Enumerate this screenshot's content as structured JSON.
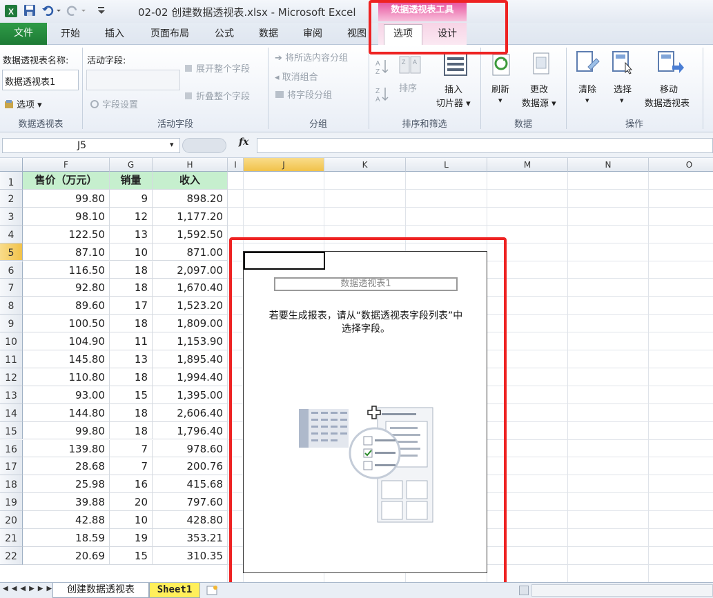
{
  "window": {
    "title": "02-02 创建数据透视表.xlsx  -  Microsoft Excel",
    "context_tools_header": "数据透视表工具"
  },
  "tabs": {
    "file": "文件",
    "items": [
      "开始",
      "插入",
      "页面布局",
      "公式",
      "数据",
      "审阅",
      "视图"
    ],
    "context_items": [
      "选项",
      "设计"
    ]
  },
  "ribbon": {
    "pivot_name_label": "数据透视表名称:",
    "pivot_name_value": "数据透视表1",
    "options_button": "选项",
    "active_field_label": "活动字段:",
    "field_settings": "字段设置",
    "expand_field": "展开整个字段",
    "collapse_field": "折叠整个字段",
    "group_selection": "将所选内容分组",
    "ungroup": "取消组合",
    "group_field": "将字段分组",
    "sort": "排序",
    "insert_slicer_1": "插入",
    "insert_slicer_2": "切片器",
    "refresh": "刷新",
    "change_source_1": "更改",
    "change_source_2": "数据源",
    "clear": "清除",
    "select": "选择",
    "move_1": "移动",
    "move_2": "数据透视表",
    "group_labels": [
      "数据透视表",
      "活动字段",
      "分组",
      "排序和筛选",
      "数据",
      "操作"
    ]
  },
  "formula_bar": {
    "name_box": "J5",
    "fx_label": "fx",
    "formula": ""
  },
  "grid": {
    "columns": [
      "F",
      "G",
      "H",
      "I",
      "J",
      "K",
      "L",
      "M",
      "N",
      "O"
    ],
    "selected_column": "J",
    "selected_row": "5",
    "row_numbers": [
      "1",
      "2",
      "3",
      "4",
      "5",
      "6",
      "7",
      "8",
      "9",
      "10",
      "11",
      "12",
      "13",
      "14",
      "15",
      "16",
      "17",
      "18",
      "19",
      "20",
      "21",
      "22"
    ],
    "headers": [
      "售价（万元）",
      "销量",
      "收入"
    ],
    "rows": [
      [
        "99.80",
        "9",
        "898.20"
      ],
      [
        "98.10",
        "12",
        "1,177.20"
      ],
      [
        "122.50",
        "13",
        "1,592.50"
      ],
      [
        "87.10",
        "10",
        "871.00"
      ],
      [
        "116.50",
        "18",
        "2,097.00"
      ],
      [
        "92.80",
        "18",
        "1,670.40"
      ],
      [
        "89.60",
        "17",
        "1,523.20"
      ],
      [
        "100.50",
        "18",
        "1,809.00"
      ],
      [
        "104.90",
        "11",
        "1,153.90"
      ],
      [
        "145.80",
        "13",
        "1,895.40"
      ],
      [
        "110.80",
        "18",
        "1,994.40"
      ],
      [
        "93.00",
        "15",
        "1,395.00"
      ],
      [
        "144.80",
        "18",
        "2,606.40"
      ],
      [
        "99.80",
        "18",
        "1,796.40"
      ],
      [
        "139.80",
        "7",
        "978.60"
      ],
      [
        "28.68",
        "7",
        "200.76"
      ],
      [
        "25.98",
        "16",
        "415.68"
      ],
      [
        "39.88",
        "20",
        "797.60"
      ],
      [
        "42.88",
        "10",
        "428.80"
      ],
      [
        "18.59",
        "19",
        "353.21"
      ],
      [
        "20.69",
        "15",
        "310.35"
      ]
    ]
  },
  "pivot_placeholder": {
    "name": "数据透视表1",
    "message_line1": "若要生成报表，请从“数据透视表字段列表”中",
    "message_line2": "选择字段。"
  },
  "sheets": {
    "active": "创建数据透视表",
    "other": "Sheet1"
  },
  "colors": {
    "file_tab": "#1d7a35",
    "context_header": "#e64b9a",
    "header_cell_fill": "#c6efce",
    "highlight_box": "#ee2222",
    "selected_header": "#f1c24a"
  }
}
